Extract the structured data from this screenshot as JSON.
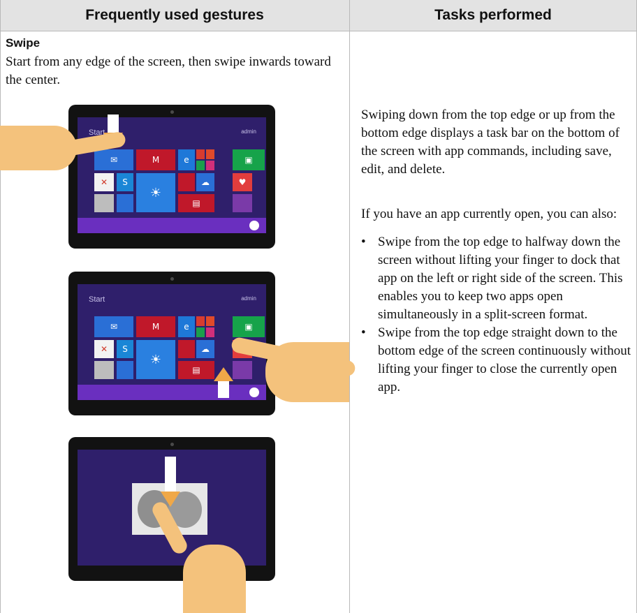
{
  "table": {
    "headers": [
      "Frequently used gestures",
      "Tasks performed"
    ]
  },
  "gesture": {
    "name": "Swipe",
    "description": "Start from any edge of the screen, then swipe inwards toward the center."
  },
  "tablet": {
    "screen_title": "Start",
    "user_label": "admin"
  },
  "tasks": {
    "intro": "Swiping down from the top edge or up from the bottom edge displays a task bar on the bottom of the screen with app commands, including save, edit, and delete.",
    "app_open": "If you have an app currently open, you can also:",
    "bullet_symbol": "•",
    "bullets": [
      "Swipe from the top edge to halfway down the screen without lifting your finger to dock that app on the left or right side of the screen. This enables you to keep two apps open simultaneously in a split-screen format.",
      "Swipe from the top edge straight down to the bottom edge of the screen continuously without lifting your finger to close the currently open app."
    ]
  },
  "colors": {
    "header_bg": "#e3e3e3",
    "start_screen_bg": "#2f1f6b",
    "taskbar": "#6a2fbf",
    "finger": "#f4c27c"
  }
}
